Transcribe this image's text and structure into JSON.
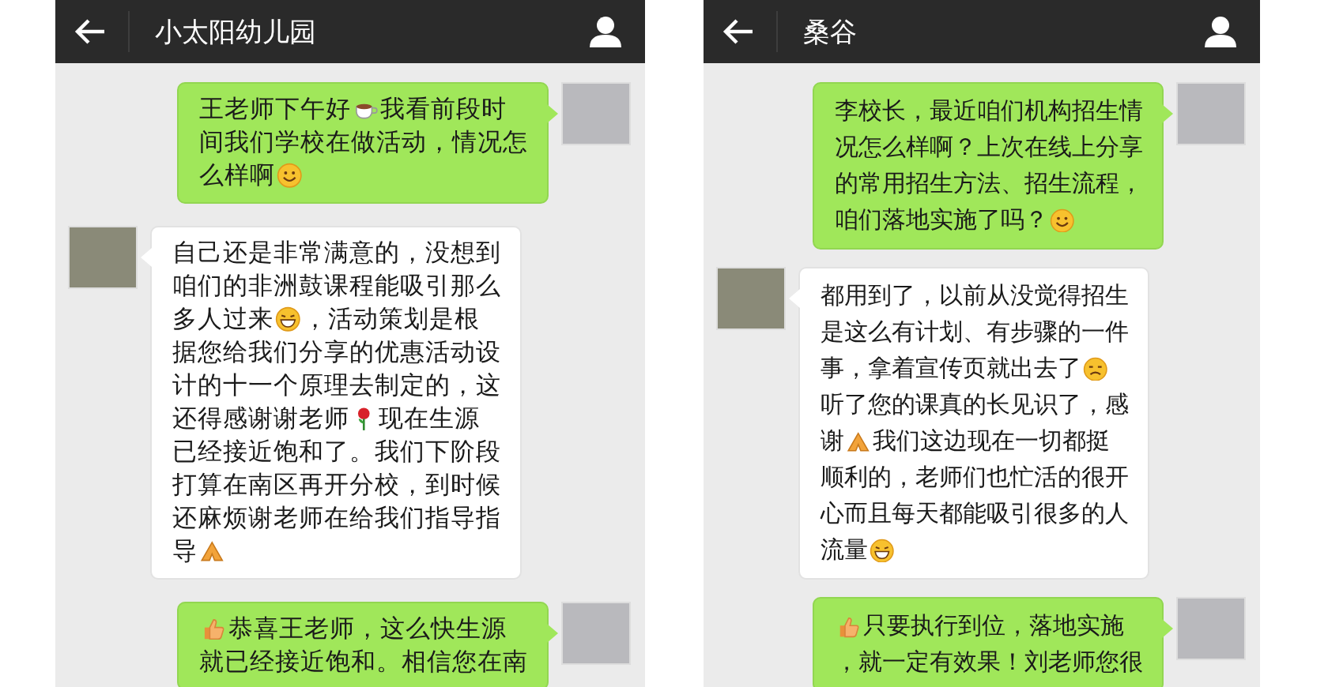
{
  "panels": [
    {
      "title": "小太阳幼儿园",
      "messages": [
        {
          "kind": "outgoing",
          "lines": [
            [
              {
                "kind": "text",
                "text": "王老师下午好"
              },
              {
                "kind": "coffee"
              },
              {
                "kind": "text",
                "text": "我看前段时"
              }
            ],
            [
              {
                "kind": "text",
                "text": "间我们学校在做活动，情况怎"
              }
            ],
            [
              {
                "kind": "text",
                "text": "么样啊"
              },
              {
                "kind": "smile"
              }
            ]
          ]
        },
        {
          "kind": "incoming",
          "lines": [
            [
              {
                "kind": "text",
                "text": "自己还是非常满意的，没想到"
              }
            ],
            [
              {
                "kind": "text",
                "text": "咱们的非洲鼓课程能吸引那么"
              }
            ],
            [
              {
                "kind": "text",
                "text": "多人过来"
              },
              {
                "kind": "grin"
              },
              {
                "kind": "text",
                "text": "，活动策划是根"
              }
            ],
            [
              {
                "kind": "text",
                "text": "据您给我们分享的优惠活动设"
              }
            ],
            [
              {
                "kind": "text",
                "text": "计的十一个原理去制定的，这"
              }
            ],
            [
              {
                "kind": "text",
                "text": "还得感谢谢老师"
              },
              {
                "kind": "rose"
              },
              {
                "kind": "text",
                "text": "现在生源"
              }
            ],
            [
              {
                "kind": "text",
                "text": "已经接近饱和了。我们下阶段"
              }
            ],
            [
              {
                "kind": "text",
                "text": "打算在南区再开分校，到时候"
              }
            ],
            [
              {
                "kind": "text",
                "text": "还麻烦谢老师在给我们指导指"
              }
            ],
            [
              {
                "kind": "text",
                "text": "导"
              },
              {
                "kind": "hands"
              }
            ]
          ]
        },
        {
          "kind": "outgoing",
          "lines": [
            [
              {
                "kind": "thumb"
              },
              {
                "kind": "text",
                "text": "恭喜王老师，这么快生源"
              }
            ],
            [
              {
                "kind": "text",
                "text": "就已经接近饱和。相信您在南"
              }
            ]
          ]
        }
      ]
    },
    {
      "title": "桑谷",
      "messages": [
        {
          "kind": "outgoing",
          "lines": [
            [
              {
                "kind": "text",
                "text": "李校长，最近咱们机构招生情"
              }
            ],
            [
              {
                "kind": "text",
                "text": "况怎么样啊？上次在线上分享"
              }
            ],
            [
              {
                "kind": "text",
                "text": "的常用招生方法、招生流程，"
              }
            ],
            [
              {
                "kind": "text",
                "text": "咱们落地实施了吗？"
              },
              {
                "kind": "smile"
              }
            ]
          ]
        },
        {
          "kind": "incoming",
          "lines": [
            [
              {
                "kind": "text",
                "text": "都用到了，以前从没觉得招生"
              }
            ],
            [
              {
                "kind": "text",
                "text": "是这么有计划、有步骤的一件"
              }
            ],
            [
              {
                "kind": "text",
                "text": "事，拿着宣传页就出去了"
              },
              {
                "kind": "grimace"
              }
            ],
            [
              {
                "kind": "text",
                "text": "听了您的课真的长见识了，感"
              }
            ],
            [
              {
                "kind": "text",
                "text": "谢"
              },
              {
                "kind": "hands"
              },
              {
                "kind": "text",
                "text": "我们这边现在一切都挺"
              }
            ],
            [
              {
                "kind": "text",
                "text": "顺利的，老师们也忙活的很开"
              }
            ],
            [
              {
                "kind": "text",
                "text": "心而且每天都能吸引很多的人"
              }
            ],
            [
              {
                "kind": "text",
                "text": "流量"
              },
              {
                "kind": "grin"
              }
            ]
          ]
        },
        {
          "kind": "outgoing",
          "lines": [
            [
              {
                "kind": "thumb"
              },
              {
                "kind": "text",
                "text": "只要执行到位，落地实施"
              }
            ],
            [
              {
                "kind": "text",
                "text": "，就一定有效果！刘老师您很"
              }
            ]
          ]
        }
      ]
    }
  ]
}
